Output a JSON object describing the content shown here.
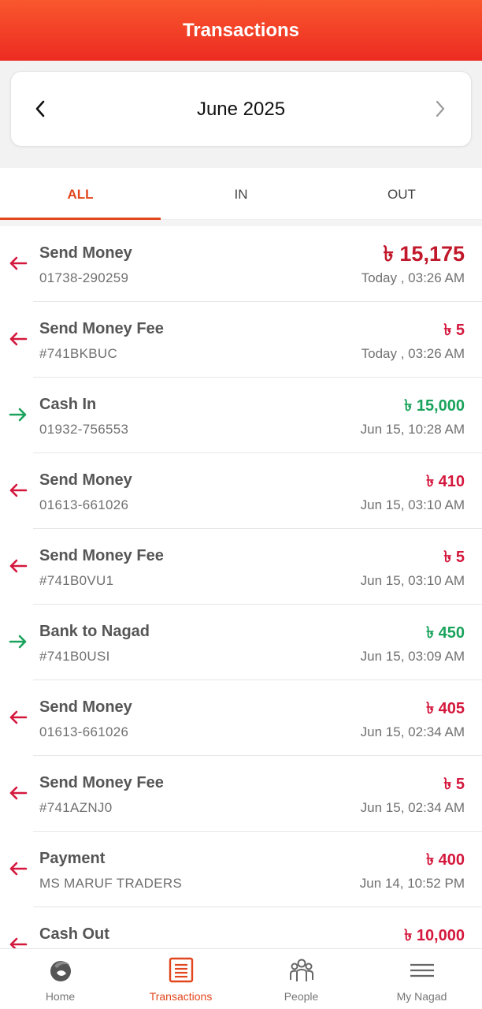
{
  "header": {
    "title": "Transactions"
  },
  "month": {
    "label": "June 2025"
  },
  "tabs": [
    {
      "label": "ALL"
    },
    {
      "label": "IN"
    },
    {
      "label": "OUT"
    }
  ],
  "transactions": [
    {
      "title": "Send Money",
      "sub": "01738-290259",
      "amount": "৳ 15,175",
      "time": "Today , 03:26 AM",
      "direction": "out"
    },
    {
      "title": "Send Money Fee",
      "sub": "#741BKBUC",
      "amount": "৳ 5",
      "time": "Today , 03:26 AM",
      "direction": "out"
    },
    {
      "title": "Cash In",
      "sub": "01932-756553",
      "amount": "৳ 15,000",
      "time": "Jun 15, 10:28 AM",
      "direction": "in"
    },
    {
      "title": "Send Money",
      "sub": "01613-661026",
      "amount": "৳ 410",
      "time": "Jun 15, 03:10 AM",
      "direction": "out"
    },
    {
      "title": "Send Money Fee",
      "sub": "#741B0VU1",
      "amount": "৳ 5",
      "time": "Jun 15, 03:10 AM",
      "direction": "out"
    },
    {
      "title": "Bank to Nagad",
      "sub": "#741B0USI",
      "amount": "৳ 450",
      "time": "Jun 15, 03:09 AM",
      "direction": "in"
    },
    {
      "title": "Send Money",
      "sub": "01613-661026",
      "amount": "৳ 405",
      "time": "Jun 15, 02:34 AM",
      "direction": "out"
    },
    {
      "title": "Send Money Fee",
      "sub": "#741AZNJ0",
      "amount": "৳ 5",
      "time": "Jun 15, 02:34 AM",
      "direction": "out"
    },
    {
      "title": "Payment",
      "sub": "MS MARUF TRADERS",
      "amount": "৳ 400",
      "time": "Jun 14, 10:52 PM",
      "direction": "out"
    },
    {
      "title": "Cash Out",
      "sub": "",
      "amount": "৳ 10,000",
      "time": "",
      "direction": "out"
    }
  ],
  "bottom_nav": [
    {
      "label": "Home",
      "icon": "home-logo-icon"
    },
    {
      "label": "Transactions",
      "icon": "transactions-icon"
    },
    {
      "label": "People",
      "icon": "people-icon"
    },
    {
      "label": "My Nagad",
      "icon": "menu-icon"
    }
  ],
  "colors": {
    "accent": "#e2461d",
    "out": "#d4183d",
    "in": "#1aa35c",
    "header": "#ec2b22"
  }
}
